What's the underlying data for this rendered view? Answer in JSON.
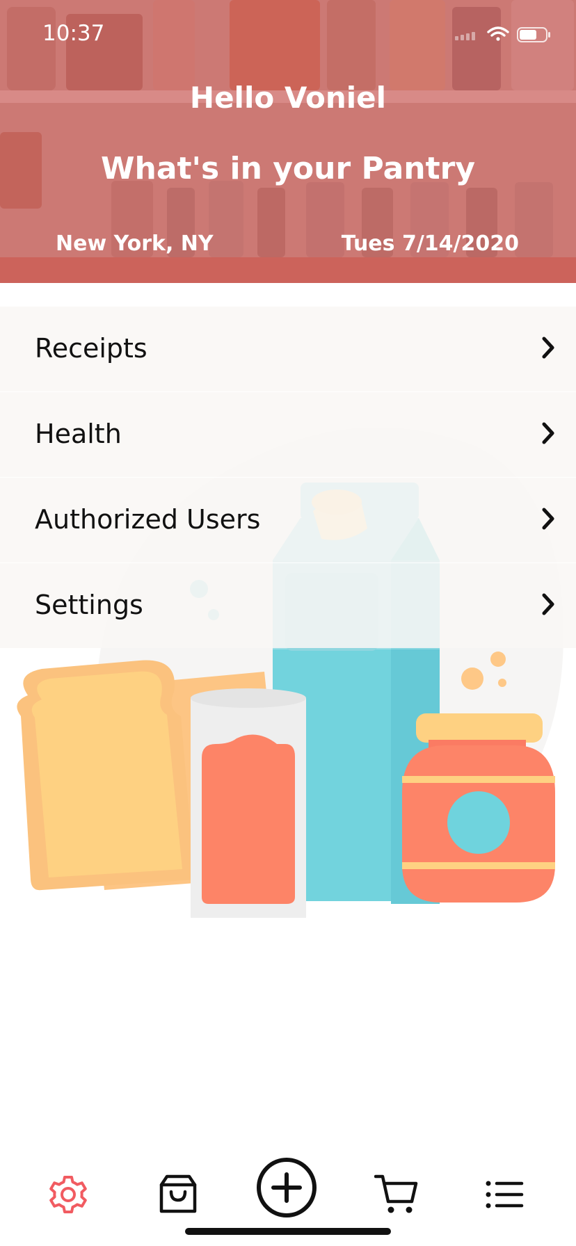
{
  "status_bar": {
    "time": "10:37"
  },
  "header": {
    "greeting": "Hello Voniel",
    "title": "What's in your Pantry",
    "location": "New York, NY",
    "date": "Tues 7/14/2020"
  },
  "menu": {
    "items": [
      {
        "label": "Receipts"
      },
      {
        "label": "Health"
      },
      {
        "label": "Authorized Users"
      },
      {
        "label": "Settings"
      }
    ]
  },
  "tabbar": {
    "tabs": [
      {
        "icon": "gear-icon",
        "active": true
      },
      {
        "icon": "shopping-bag-icon",
        "active": false
      },
      {
        "icon": "add-circle-icon",
        "active": false
      },
      {
        "icon": "cart-icon",
        "active": false
      },
      {
        "icon": "list-icon",
        "active": false
      }
    ]
  },
  "colors": {
    "header_tint": "#cf6d70",
    "accent": "#f15b61",
    "milk": "#6fd3dd",
    "juice": "#fe8468",
    "bread": "#fdd182"
  }
}
